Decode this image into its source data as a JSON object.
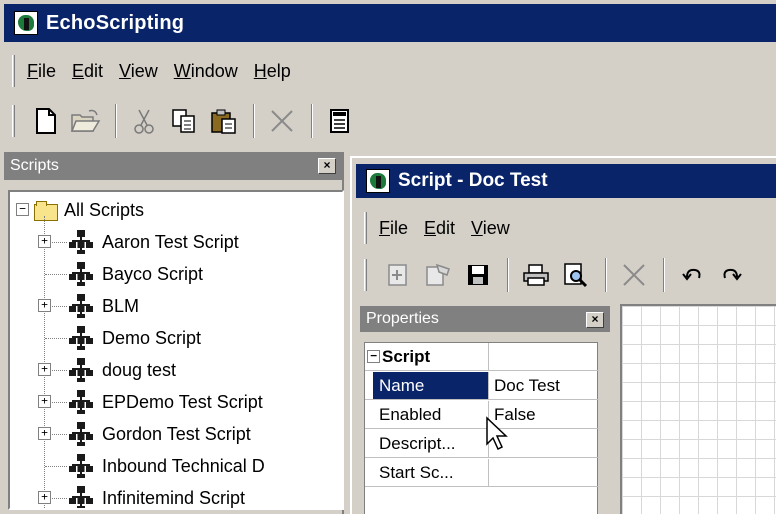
{
  "app": {
    "title": "EchoScripting"
  },
  "menu": {
    "items": [
      {
        "label": "File",
        "accel": "F",
        "rest": "ile"
      },
      {
        "label": "Edit",
        "accel": "E",
        "rest": "dit"
      },
      {
        "label": "View",
        "accel": "V",
        "rest": "iew"
      },
      {
        "label": "Window",
        "accel": "W",
        "rest": "indow"
      },
      {
        "label": "Help",
        "accel": "H",
        "rest": "elp"
      }
    ]
  },
  "scripts_panel": {
    "title": "Scripts",
    "close": "×",
    "root": {
      "label": "All Scripts",
      "expander": "−"
    },
    "items": [
      {
        "label": "Aaron Test Script",
        "expander": "+"
      },
      {
        "label": "Bayco Script",
        "expander": ""
      },
      {
        "label": "BLM",
        "expander": "+"
      },
      {
        "label": "Demo Script",
        "expander": ""
      },
      {
        "label": "doug test",
        "expander": "+"
      },
      {
        "label": "EPDemo Test Script",
        "expander": "+"
      },
      {
        "label": "Gordon Test Script",
        "expander": "+"
      },
      {
        "label": "Inbound Technical D",
        "expander": ""
      },
      {
        "label": "Infinitemind Script",
        "expander": "+"
      }
    ]
  },
  "child_window": {
    "title": "Script - Doc Test",
    "menu": [
      {
        "label": "File",
        "accel": "F",
        "rest": "ile"
      },
      {
        "label": "Edit",
        "accel": "E",
        "rest": "dit"
      },
      {
        "label": "View",
        "accel": "V",
        "rest": "iew"
      }
    ]
  },
  "properties": {
    "title": "Properties",
    "close": "×",
    "section": {
      "label": "Script",
      "expander": "−"
    },
    "rows": [
      {
        "name": "Name",
        "value": "Doc Test"
      },
      {
        "name": "Enabled",
        "value": "False"
      },
      {
        "name": "Descript...",
        "value": ""
      },
      {
        "name": "Start Sc...",
        "value": ""
      }
    ]
  },
  "colors": {
    "title_active": "#0a246a",
    "panel_header": "#808080",
    "face": "#d4d0c8",
    "selection": "#0a246a"
  }
}
